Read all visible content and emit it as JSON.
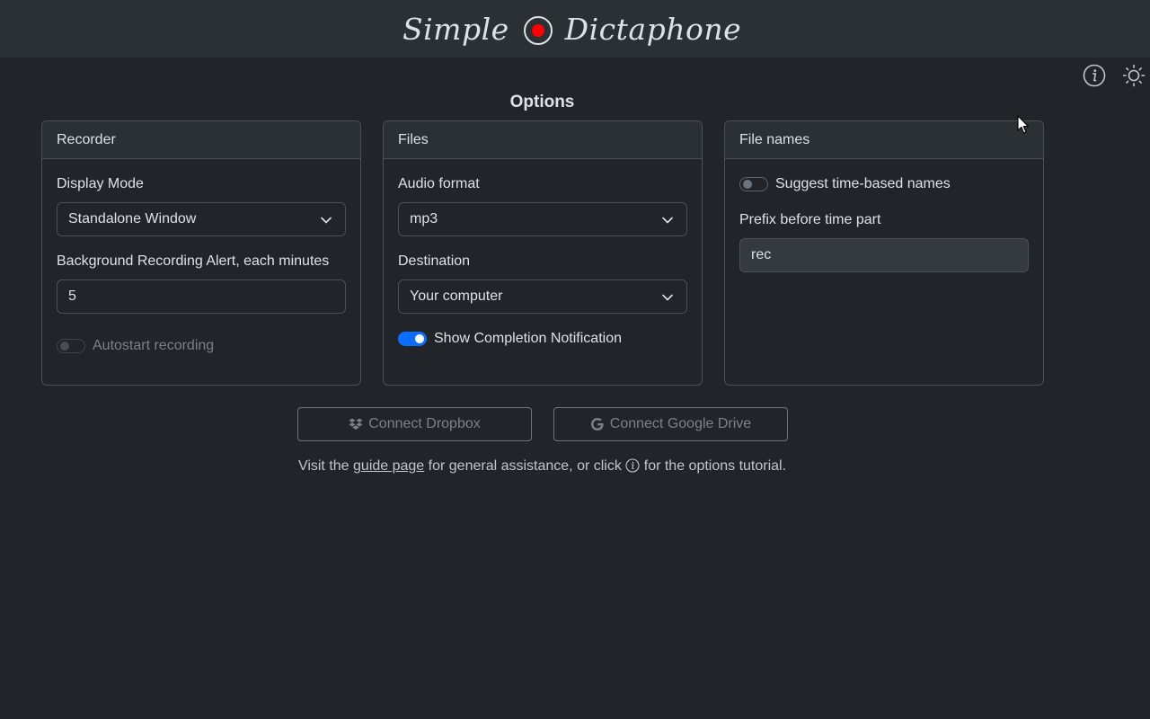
{
  "app": {
    "logo_left": "Simple",
    "logo_right": "Dictaphone",
    "record_color": "#ff0000"
  },
  "header_icons": {
    "info": "info-icon",
    "theme": "sun-icon"
  },
  "page_title": "Options",
  "recorder": {
    "header": "Recorder",
    "display_mode_label": "Display Mode",
    "display_mode_value": "Standalone Window",
    "alert_label": "Background Recording Alert, each minutes",
    "alert_value": "5",
    "autostart_label": "Autostart recording",
    "autostart_on": false,
    "autostart_disabled": true
  },
  "files": {
    "header": "Files",
    "format_label": "Audio format",
    "format_value": "mp3",
    "destination_label": "Destination",
    "destination_value": "Your computer",
    "notification_label": "Show Completion Notification",
    "notification_on": true
  },
  "file_names": {
    "header": "File names",
    "suggest_label": "Suggest time-based names",
    "suggest_on": false,
    "prefix_label": "Prefix before time part",
    "prefix_value": "rec"
  },
  "cloud": {
    "dropbox_label": "Connect Dropbox",
    "gdrive_label": "Connect Google Drive"
  },
  "footer": {
    "text_before": "Visit the ",
    "link_text": "guide page",
    "text_middle": " for general assistance, or click ",
    "text_after": " for the options tutorial."
  },
  "colors": {
    "background": "#212529",
    "accent": "#0d6efd",
    "border": "#495057"
  }
}
